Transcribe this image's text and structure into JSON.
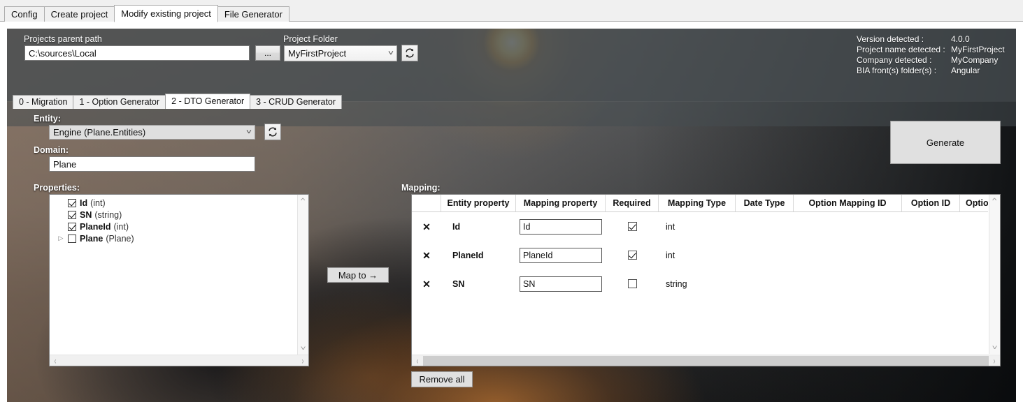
{
  "top_tabs": [
    {
      "label": "Config",
      "active": false
    },
    {
      "label": "Create project",
      "active": false
    },
    {
      "label": "Modify existing project",
      "active": true
    },
    {
      "label": "File Generator",
      "active": false
    }
  ],
  "header": {
    "parent_path_label": "Projects parent path",
    "parent_path_value": "C:\\sources\\Local",
    "browse_label": "...",
    "project_folder_label": "Project Folder",
    "project_folder_value": "MyFirstProject",
    "refresh_icon": "refresh-icon",
    "info_rows": [
      {
        "label": "Version detected :",
        "value": "4.0.0"
      },
      {
        "label": "Project name detected :",
        "value": "MyFirstProject"
      },
      {
        "label": "Company detected :",
        "value": "MyCompany"
      },
      {
        "label": "BIA front(s) folder(s) :",
        "value": "Angular"
      }
    ]
  },
  "sub_tabs": [
    {
      "label": "0 - Migration",
      "active": false
    },
    {
      "label": "1 - Option Generator",
      "active": false
    },
    {
      "label": "2 - DTO Generator",
      "active": true
    },
    {
      "label": "3 - CRUD Generator",
      "active": false
    }
  ],
  "form": {
    "entity_label": "Entity:",
    "entity_value": "Engine (Plane.Entities)",
    "entity_refresh_icon": "refresh-icon",
    "domain_label": "Domain:",
    "domain_value": "Plane",
    "generate_label": "Generate"
  },
  "properties": {
    "label": "Properties:",
    "items": [
      {
        "name": "Id",
        "type": "(int)",
        "checked": true,
        "expandable": false
      },
      {
        "name": "SN",
        "type": "(string)",
        "checked": true,
        "expandable": false
      },
      {
        "name": "PlaneId",
        "type": "(int)",
        "checked": true,
        "expandable": false
      },
      {
        "name": "Plane",
        "type": "(Plane)",
        "checked": false,
        "expandable": true
      }
    ]
  },
  "map_button_label": "Map to →",
  "mapping": {
    "label": "Mapping:",
    "columns": [
      "",
      "Entity property",
      "Mapping property",
      "Required",
      "Mapping Type",
      "Date Type",
      "Option Mapping ID",
      "Option ID",
      "Option Di"
    ],
    "rows": [
      {
        "remove_icon": "close-icon",
        "entity_property": "Id",
        "mapping_property": "Id",
        "required": true,
        "mapping_type": "int",
        "date_type": "",
        "option_mapping_id": "",
        "option_id": "",
        "option_display": ""
      },
      {
        "remove_icon": "close-icon",
        "entity_property": "PlaneId",
        "mapping_property": "PlaneId",
        "required": true,
        "mapping_type": "int",
        "date_type": "",
        "option_mapping_id": "",
        "option_id": "",
        "option_display": ""
      },
      {
        "remove_icon": "close-icon",
        "entity_property": "SN",
        "mapping_property": "SN",
        "required": false,
        "mapping_type": "string",
        "date_type": "",
        "option_mapping_id": "",
        "option_id": "",
        "option_display": ""
      }
    ],
    "remove_all_label": "Remove all"
  },
  "colors": {
    "panel_overlay": "#464c50",
    "tab_active": "#ffffff",
    "button_face": "#e0e0e0"
  }
}
